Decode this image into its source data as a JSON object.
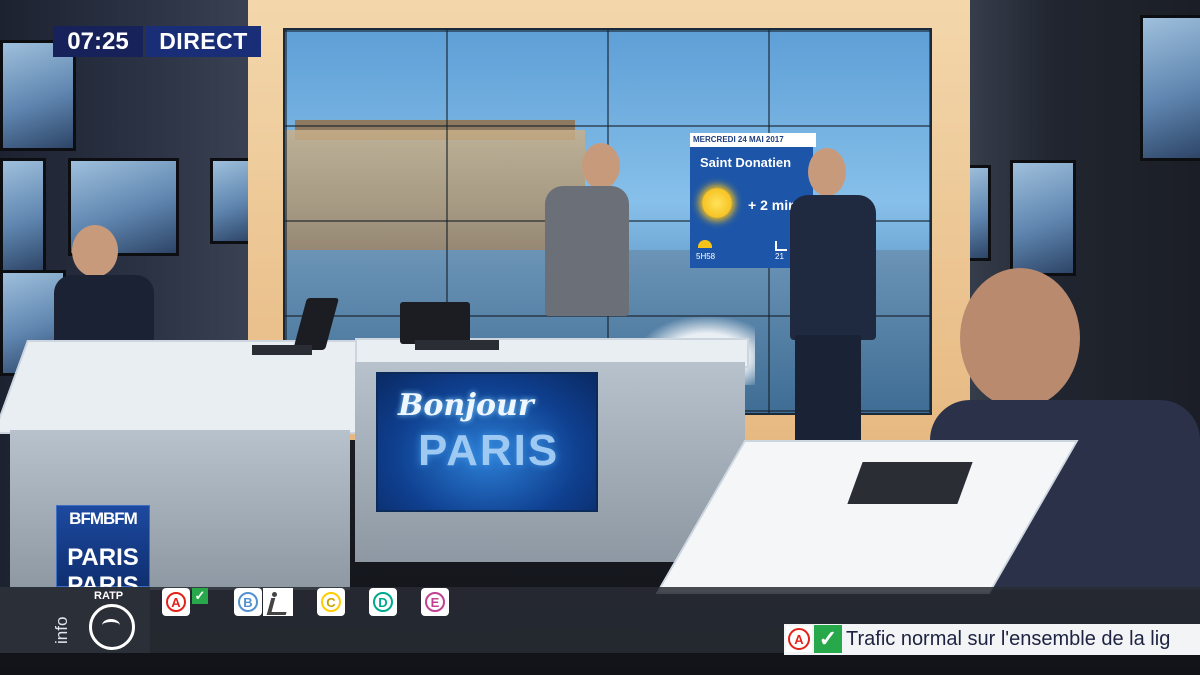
{
  "broadcast": {
    "time": "07:25",
    "live_label": "DIRECT"
  },
  "weather_card": {
    "date": "MERCREDI 24 MAI 2017",
    "saint": "Saint Donatien",
    "daylight_gain": "+ 2 min",
    "sunrise": "5H58",
    "sunset": "21"
  },
  "show_logo": {
    "line1": "Bonjour",
    "line2": "PARIS"
  },
  "channel_logo": {
    "line1": "BFMBFM",
    "line2": "PARIS PARIS"
  },
  "info_bar": {
    "label": "info",
    "operator": "RATP",
    "lines": [
      {
        "letter": "A",
        "color": "#e2231a",
        "status": "ok"
      },
      {
        "letter": "B",
        "color": "#5291ce",
        "status": "works"
      },
      {
        "letter": "C",
        "color": "#ffcd00",
        "status": ""
      },
      {
        "letter": "D",
        "color": "#00a88f",
        "status": ""
      },
      {
        "letter": "E",
        "color": "#c04191",
        "status": ""
      }
    ],
    "ticker": {
      "line": "A",
      "line_color": "#e2231a",
      "text": "Trafic normal sur l'ensemble de la lig"
    }
  }
}
